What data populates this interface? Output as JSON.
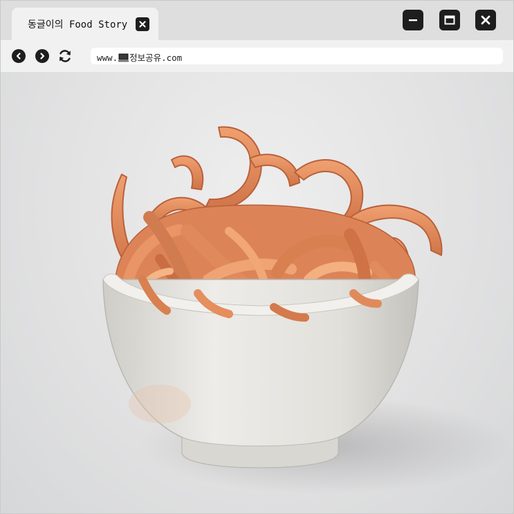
{
  "tab": {
    "title": "동글이의 Food Story",
    "close_icon": "close-icon"
  },
  "window_controls": {
    "minimize_icon": "minimize-icon",
    "maximize_icon": "maximize-icon",
    "close_icon": "close-icon"
  },
  "nav": {
    "back_icon": "chevron-left-icon",
    "forward_icon": "chevron-right-icon",
    "reload_icon": "refresh-icon"
  },
  "address": {
    "prefix": "www.",
    "domain": "정보공유.com",
    "site_icon": "computer-icon"
  },
  "content": {
    "image": "bowl of dried sweet potato strips",
    "colors": {
      "background": "#e4e4e5",
      "bowl": "#e8e6e1",
      "strips": "#e08a5c"
    }
  },
  "colors": {
    "tabbar": "#dedede",
    "navbar": "#f1f1f1",
    "tab": "#f1f1f1",
    "control": "#1e1e1e"
  }
}
